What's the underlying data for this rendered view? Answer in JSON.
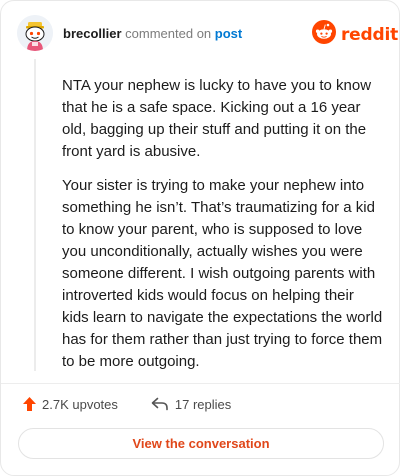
{
  "header": {
    "username": "brecollier",
    "action": "commented on",
    "target": "post",
    "brand": "reddit"
  },
  "comment": {
    "paragraphs": [
      "NTA your nephew is lucky to have you to know that he is a safe space. Kicking out a 16 year old, bagging up their stuff and putting it on the front yard is abusive.",
      "Your sister is trying to make your nephew into something he isn’t. That’s traumatizing for a kid to know your parent, who is supposed to love you unconditionally, actually wishes you were someone different. I wish outgoing parents with introverted kids would focus on helping their kids learn to navigate the expectations the world has for them rather than just trying to force them to be more outgoing."
    ]
  },
  "stats": {
    "upvotes": "2.7K upvotes",
    "replies": "17 replies"
  },
  "actions": {
    "view_conversation": "View the conversation"
  },
  "icons": {
    "avatar": "snoo-avatar-icon",
    "logo": "reddit-snoo-icon",
    "upvote": "upvote-arrow-icon",
    "reply": "reply-arrow-icon"
  },
  "colors": {
    "brand": "#ff4500",
    "link": "#0079d3",
    "button_text": "#e0471a",
    "muted": "#7c7c7c"
  }
}
